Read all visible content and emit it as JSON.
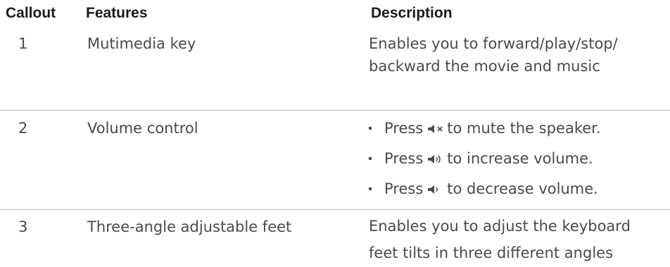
{
  "header": {
    "callout": "Callout",
    "features": "Features",
    "description": "Description"
  },
  "rows": [
    {
      "callout": "1",
      "feature": "Mutimedia key",
      "description": "Enables you to forward/play/stop/ backward the movie and music"
    },
    {
      "callout": "2",
      "feature": "Volume control",
      "bullets": [
        {
          "before": "Press",
          "icon": "speaker-mute-icon",
          "after": "to mute the speaker."
        },
        {
          "before": "Press",
          "icon": "speaker-volume-up-icon",
          "after": "to increase volume."
        },
        {
          "before": "Press",
          "icon": "speaker-volume-down-icon",
          "after": "to decrease volume."
        }
      ]
    },
    {
      "callout": "3",
      "feature": "Three-angle adjustable feet",
      "description": "Enables you to adjust the keyboard feet tilts in three different angles"
    }
  ]
}
